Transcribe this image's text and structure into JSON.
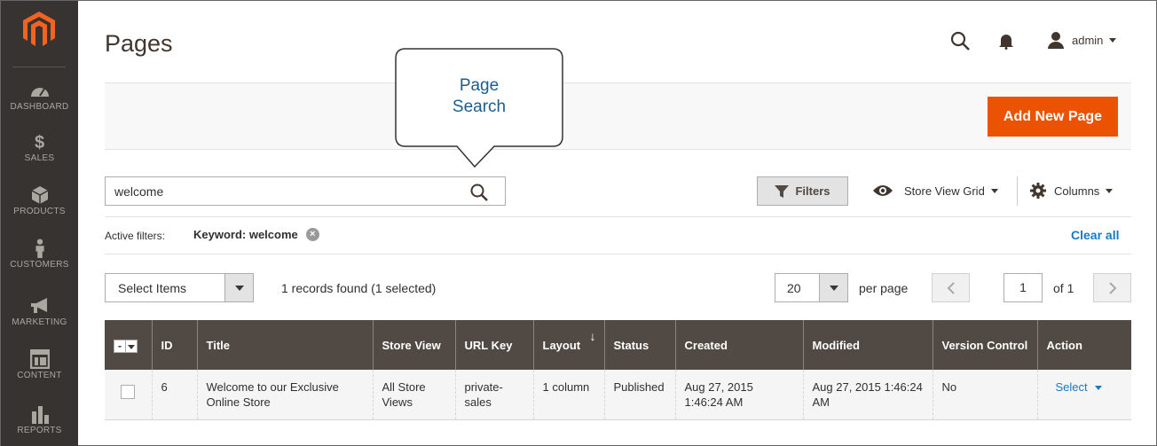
{
  "sidebar": {
    "logo": "magento-logo",
    "items": [
      {
        "label": "DASHBOARD",
        "icon": "dashboard-icon"
      },
      {
        "label": "SALES",
        "icon": "dollar-icon"
      },
      {
        "label": "PRODUCTS",
        "icon": "cube-icon"
      },
      {
        "label": "CUSTOMERS",
        "icon": "person-icon"
      },
      {
        "label": "MARKETING",
        "icon": "megaphone-icon"
      },
      {
        "label": "CONTENT",
        "icon": "layout-icon"
      },
      {
        "label": "REPORTS",
        "icon": "bar-chart-icon"
      }
    ]
  },
  "header": {
    "title": "Pages",
    "user": "admin"
  },
  "actions": {
    "add_new": "Add New Page"
  },
  "callout": {
    "line1": "Page",
    "line2": "Search"
  },
  "search": {
    "value": "welcome"
  },
  "toolbar": {
    "filters": "Filters",
    "store_view": "Store View Grid",
    "columns": "Columns"
  },
  "filters": {
    "label": "Active filters:",
    "chip": "Keyword: welcome",
    "clear": "Clear all"
  },
  "grid_controls": {
    "mass_action": "Select Items",
    "records": "1 records found (1 selected)",
    "per_page_value": "20",
    "per_page_label": "per page",
    "page": "1",
    "of": "of 1"
  },
  "table": {
    "mass_select_label": "-",
    "columns": [
      "ID",
      "Title",
      "Store View",
      "URL Key",
      "Layout",
      "Status",
      "Created",
      "Modified",
      "Version Control",
      "Action"
    ],
    "rows": [
      {
        "id": "6",
        "title": "Welcome to our Exclusive Online Store",
        "store_view": "All Store Views",
        "url_key": "private-sales",
        "layout": "1 column",
        "status": "Published",
        "created": "Aug 27, 2015 1:46:24 AM",
        "modified": "Aug 27, 2015 1:46:24 AM",
        "version_control": "No",
        "action": "Select"
      }
    ]
  },
  "colors": {
    "sidebar_bg": "#373330",
    "accent": "#eb5202",
    "table_header": "#514943",
    "link": "#1979c3"
  }
}
